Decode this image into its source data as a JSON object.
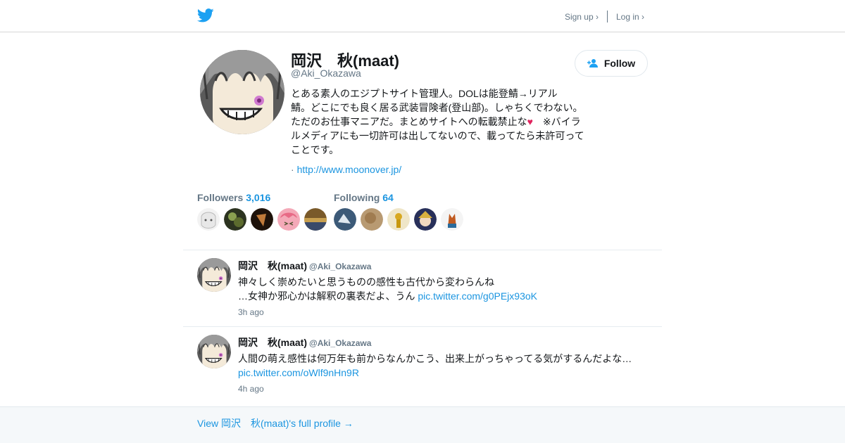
{
  "header": {
    "logo_icon": "twitter-bird-icon",
    "signup_label": "Sign up ›",
    "login_label": "Log in ›"
  },
  "profile": {
    "name": "岡沢　秋(maat)",
    "handle": "@Aki_Okazawa",
    "follow_label": "Follow",
    "bio_lines": [
      "とある素人のエジプトサイト管理人。DOLは能登鯖→リアル",
      "鯖。どこにでも良く居る武装冒険者(登山部)。しゃちくでわない。",
      "ただのお仕事マニアだ。まとめサイトへの転載禁止な",
      "ルメディアにも一切許可は出してないので、載ってたら未許可って",
      "ことです。"
    ],
    "bio_heart": "♥",
    "bio_line3_tail": "　※バイラ",
    "url_prefix": "·",
    "url": "http://www.moonover.jp/"
  },
  "followers": {
    "label": "Followers",
    "count": "3,016"
  },
  "following": {
    "label": "Following",
    "count": "64"
  },
  "tweets": [
    {
      "name": "岡沢　秋(maat)",
      "handle": "@Aki_Okazawa",
      "text_line1": "神々しく崇めたいと思うものの感性も古代から変わらんね",
      "text_line2": "…女神か邪心かは解釈の裏表だよ、うん",
      "link": "pic.twitter.com/g0PEjx93oK",
      "time": "3h ago"
    },
    {
      "name": "岡沢　秋(maat)",
      "handle": "@Aki_Okazawa",
      "text_line1": "人間の萌え感性は何万年も前からなんかこう、出来上がっちゃってる気がするんだよな…",
      "text_line2": "",
      "link": "pic.twitter.com/oWlf9nHn9R",
      "time": "4h ago"
    }
  ],
  "footer": {
    "full_profile_label": "View 岡沢　秋(maat)'s full profile →"
  },
  "colors": {
    "link": "#1b95e0",
    "muted": "#657786",
    "text": "#14171a",
    "brand": "#1da1f2"
  }
}
